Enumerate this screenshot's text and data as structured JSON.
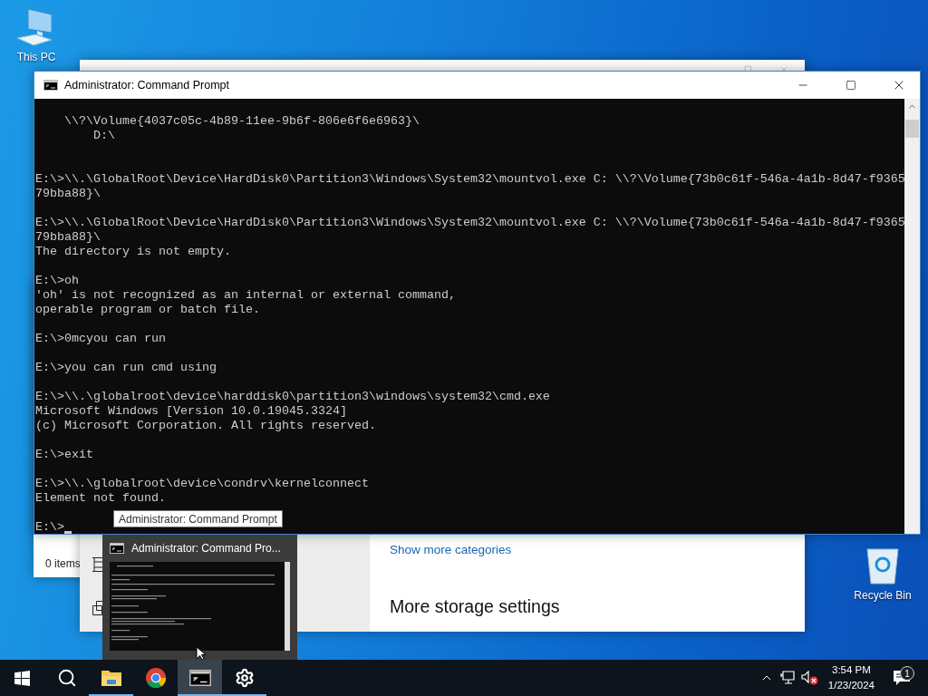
{
  "desktop_icons": [
    {
      "kind": "computer",
      "label": "This PC"
    },
    {
      "kind": "recycle",
      "label": "Recycle Bin"
    }
  ],
  "explorer_window": {
    "status": "0 items"
  },
  "settings_window": {
    "link": "Show more categories",
    "heading": "More storage settings"
  },
  "cmd_window": {
    "title": "Administrator: Command Prompt",
    "blocks": [
      {
        "kind": "listing",
        "items": [
          {
            "text": "\\\\?\\Volume{4037c05c-4b89-11ee-9b6f-806e6f6e6963}\\",
            "children": [
              {
                "text": "D:\\"
              }
            ]
          }
        ]
      },
      {
        "kind": "command",
        "lines": [
          "E:\\>\\\\.\\GlobalRoot\\Device\\HardDisk0\\Partition3\\Windows\\System32\\mountvol.exe C: \\\\?\\Volume{73b0c61f-546a-4a1b-8d47-f9365",
          "79bba88}\\"
        ]
      },
      {
        "kind": "command",
        "lines": [
          "E:\\>\\\\.\\GlobalRoot\\Device\\HardDisk0\\Partition3\\Windows\\System32\\mountvol.exe C: \\\\?\\Volume{73b0c61f-546a-4a1b-8d47-f9365",
          "79bba88}\\",
          "The directory is not empty."
        ]
      },
      {
        "kind": "command",
        "lines": [
          "E:\\>oh",
          "'oh' is not recognized as an internal or external command,",
          "operable program or batch file."
        ]
      },
      {
        "kind": "command",
        "lines": [
          "E:\\>0mcyou can run"
        ]
      },
      {
        "kind": "command",
        "lines": [
          "E:\\>you can run cmd using"
        ]
      },
      {
        "kind": "command",
        "lines": [
          "E:\\>\\\\.\\globalroot\\device\\harddisk0\\partition3\\windows\\system32\\cmd.exe",
          "Microsoft Windows [Version 10.0.19045.3324]",
          "(c) Microsoft Corporation. All rights reserved."
        ]
      },
      {
        "kind": "command",
        "lines": [
          "E:\\>exit"
        ]
      },
      {
        "kind": "command",
        "lines": [
          "E:\\>\\\\.\\globalroot\\device\\condrv\\kernelconnect",
          "Element not found."
        ]
      },
      {
        "kind": "prompt",
        "lines": [
          "E:\\>"
        ]
      }
    ]
  },
  "tooltip": "Administrator: Command Prompt",
  "preview": {
    "title": "Administrator: Command Pro..."
  },
  "taskbar": {
    "apps": [
      {
        "kind": "start",
        "running": false,
        "selected": false
      },
      {
        "kind": "search",
        "running": false,
        "selected": false
      },
      {
        "kind": "explorer",
        "running": true,
        "selected": false
      },
      {
        "kind": "chrome",
        "running": false,
        "selected": false
      },
      {
        "kind": "cmd",
        "running": true,
        "selected": true
      },
      {
        "kind": "settings",
        "running": true,
        "selected": false
      }
    ],
    "time": "3:54 PM",
    "date": "1/23/2024",
    "notification_count": "1"
  }
}
